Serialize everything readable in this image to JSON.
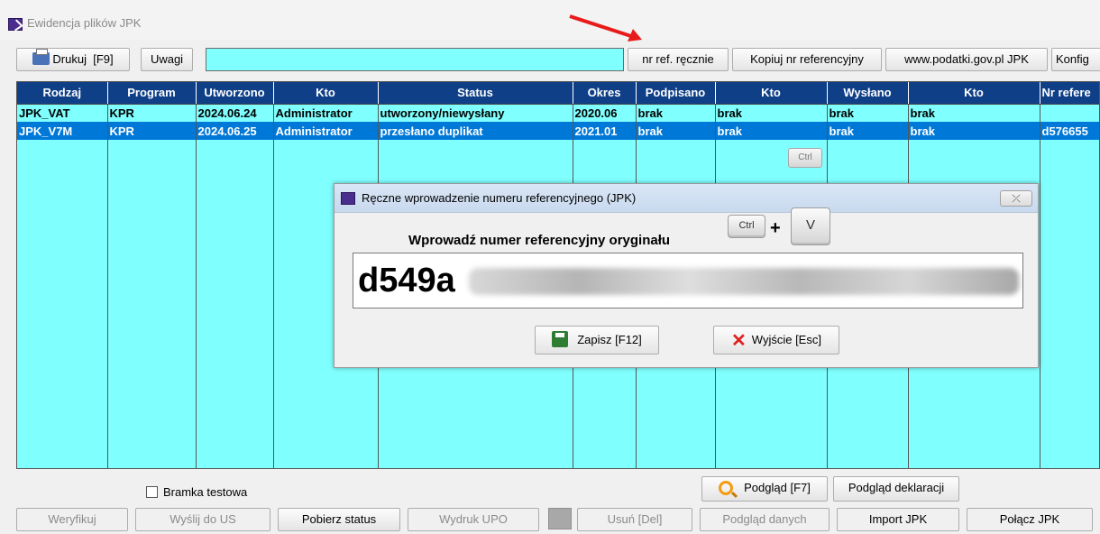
{
  "window": {
    "title": "Ewidencja plików JPK"
  },
  "toolbar": {
    "print_label": "Drukuj",
    "print_shortcut": "[F9]",
    "notes_label": "Uwagi",
    "manual_ref_label": "nr ref. ręcznie",
    "copy_ref_label": "Kopiuj nr referencyjny",
    "podatki_label": "www.podatki.gov.pl  JPK",
    "config_label": "Konfig",
    "input_value": ""
  },
  "table": {
    "columns": [
      "Rodzaj",
      "Program",
      "Utworzono",
      "Kto",
      "Status",
      "Okres",
      "Podpisano",
      "Kto",
      "Wysłano",
      "Kto",
      "Nr refere"
    ],
    "rows": [
      [
        "JPK_VAT",
        "KPR",
        "2024.06.24",
        "Administrator",
        "utworzony/niewysłany",
        "2020.06",
        "brak",
        "brak",
        "brak",
        "brak",
        ""
      ],
      [
        "JPK_V7M",
        "KPR",
        "2024.06.25",
        "Administrator",
        "przesłano duplikat",
        "2021.01",
        "brak",
        "brak",
        "brak",
        "brak",
        "d576655"
      ]
    ],
    "selected_row": 1
  },
  "overlay": {
    "ctrl_key": "Ctrl"
  },
  "dialog": {
    "title": "Ręczne wprowadzenie numeru referencyjnego (JPK)",
    "close_label": "⤫",
    "label": "Wprowadź numer referencyjny oryginału",
    "ctrl_key": "Ctrl",
    "plus": "+",
    "v_key": "V",
    "ref_value": "d549a",
    "save_label": "Zapisz  [F12]",
    "exit_label": "Wyjście  [Esc]"
  },
  "bottom": {
    "test_gateway_label": "Bramka testowa",
    "test_gateway_checked": false,
    "preview_label": "Podgląd  [F7]",
    "preview_declaration_label": "Podgląd deklaracji",
    "verify_label": "Weryfikuj",
    "send_label": "Wyślij do US",
    "get_status_label": "Pobierz status",
    "print_upo_label": "Wydruk UPO",
    "delete_label": "Usuń  [Del]",
    "data_preview_label": "Podgląd danych",
    "import_label": "Import JPK",
    "merge_label": "Połącz JPK"
  },
  "colors": {
    "grid_bg": "#80ffff",
    "header_bg": "#0f3f87",
    "selected_bg": "#0078d7",
    "arrow": "#e81b1b"
  },
  "icons": [
    "printer-icon",
    "app-icon",
    "save-icon",
    "x-icon",
    "search-icon",
    "close-icon",
    "arrow-annotation"
  ]
}
